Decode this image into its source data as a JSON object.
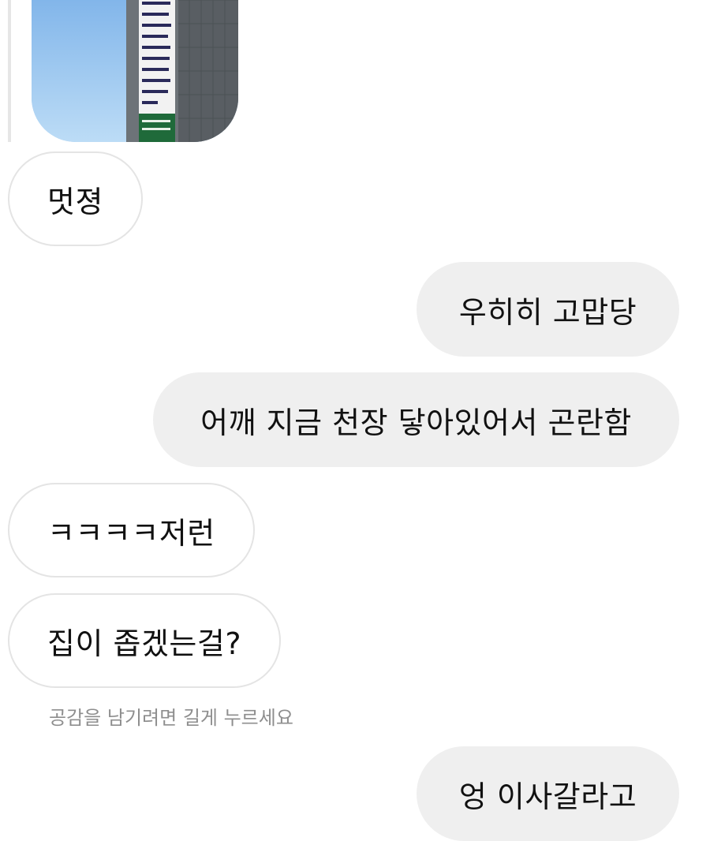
{
  "messages": {
    "m1": "멋졍",
    "m2": "우히히 고맙당",
    "m3": "어깨 지금 천장 닿아있어서 곤란함",
    "m4": "ㅋㅋㅋㅋ저런",
    "m5": "집이 좁겠는걸?",
    "m6": "엉 이사갈라고"
  },
  "hint": "공감을 남기려면 길게 누르세요",
  "colors": {
    "outgoing_bubble": "#efefef",
    "incoming_border": "#e4e4e4",
    "hint_text": "#8e8e8e"
  }
}
